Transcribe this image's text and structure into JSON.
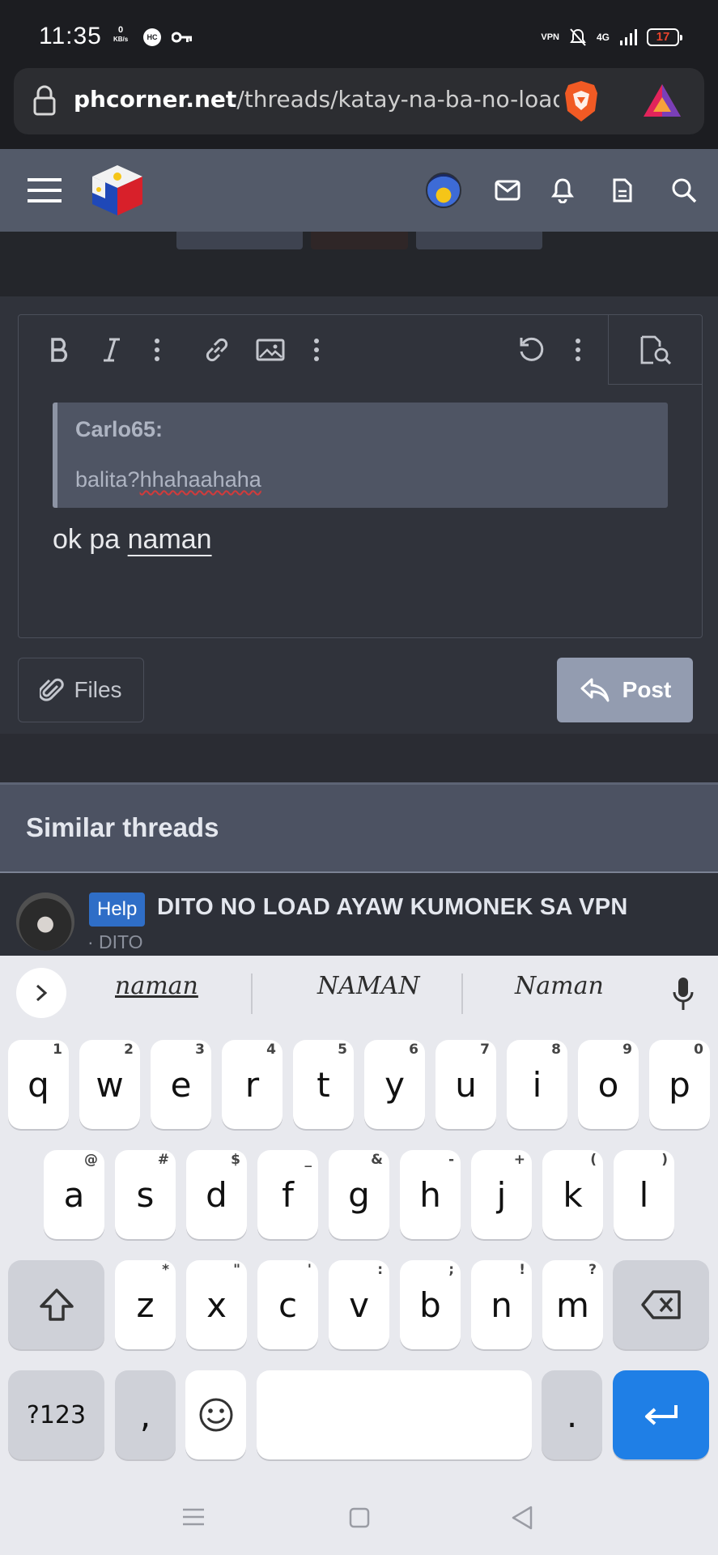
{
  "status_bar": {
    "time": "11:35",
    "speed_value": "0",
    "speed_unit": "KB/s",
    "hc_label": "HC",
    "network": "4G",
    "vpn_label": "VPN",
    "battery": "17"
  },
  "browser": {
    "url_domain": "phcorner.net",
    "url_path": "/threads/katay-na-ba-no-load-or-o"
  },
  "editor": {
    "quote_author": "Carlo65:",
    "quote_text_plain": "balita?",
    "quote_text_flagged": "hhahaahaha",
    "reply_text_plain": "ok pa ",
    "reply_text_word": "naman"
  },
  "actions": {
    "files_label": "Files",
    "post_label": "Post"
  },
  "similar_threads": {
    "title": "Similar threads",
    "items": [
      {
        "badge": "Help",
        "title": "DITO NO LOAD AYAW KUMONEK SA VPN",
        "forum": "· DITO"
      }
    ]
  },
  "keyboard": {
    "suggestions": [
      "naman",
      "NAMAN",
      "Naman"
    ],
    "row1": [
      {
        "k": "q",
        "h": "1"
      },
      {
        "k": "w",
        "h": "2"
      },
      {
        "k": "e",
        "h": "3"
      },
      {
        "k": "r",
        "h": "4"
      },
      {
        "k": "t",
        "h": "5"
      },
      {
        "k": "y",
        "h": "6"
      },
      {
        "k": "u",
        "h": "7"
      },
      {
        "k": "i",
        "h": "8"
      },
      {
        "k": "o",
        "h": "9"
      },
      {
        "k": "p",
        "h": "0"
      }
    ],
    "row2": [
      {
        "k": "a",
        "h": "@"
      },
      {
        "k": "s",
        "h": "#"
      },
      {
        "k": "d",
        "h": "$"
      },
      {
        "k": "f",
        "h": "_"
      },
      {
        "k": "g",
        "h": "&"
      },
      {
        "k": "h",
        "h": "-"
      },
      {
        "k": "j",
        "h": "+"
      },
      {
        "k": "k",
        "h": "("
      },
      {
        "k": "l",
        "h": ")"
      }
    ],
    "row3": [
      {
        "k": "z",
        "h": "*"
      },
      {
        "k": "x",
        "h": "\""
      },
      {
        "k": "c",
        "h": "'"
      },
      {
        "k": "v",
        "h": ":"
      },
      {
        "k": "b",
        "h": ";"
      },
      {
        "k": "n",
        "h": "!"
      },
      {
        "k": "m",
        "h": "?"
      }
    ],
    "symbols_label": "?123",
    "comma": ",",
    "period": "."
  },
  "colors": {
    "header_bg": "#535a69",
    "post_button": "#939cb0",
    "help_badge": "#2f6ec7",
    "enter_key": "#1f7fe6"
  }
}
